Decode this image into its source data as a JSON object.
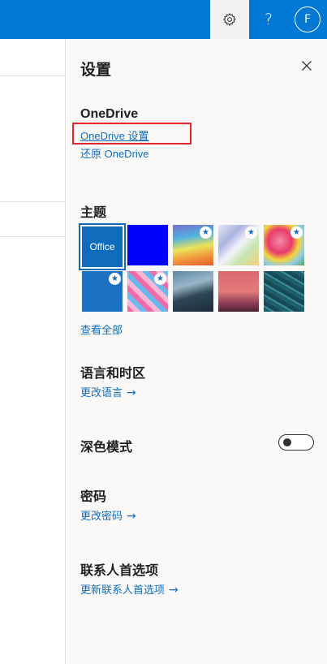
{
  "topbar": {
    "settings_icon": "gear-icon",
    "help_label": "?",
    "avatar_initial": "F",
    "bg_color": "#0078d4"
  },
  "panel": {
    "title": "设置",
    "close_icon": "close-icon",
    "onedrive": {
      "title": "OneDrive",
      "settings_link": "OneDrive 设置",
      "restore_link": "还原 OneDrive"
    },
    "theme": {
      "title": "主题",
      "items": [
        {
          "name": "Office",
          "label": "Office",
          "starred": false
        },
        {
          "name": "Blue",
          "starred": false
        },
        {
          "name": "Rainbow waves",
          "starred": true
        },
        {
          "name": "Pastel streaks",
          "starred": true
        },
        {
          "name": "Unicorn",
          "starred": true
        },
        {
          "name": "Blueprint",
          "starred": true
        },
        {
          "name": "Colorful circuit",
          "starred": true
        },
        {
          "name": "Mountain",
          "starred": false
        },
        {
          "name": "Palm sunset",
          "starred": false
        },
        {
          "name": "Circuit",
          "starred": false
        }
      ],
      "view_all": "查看全部"
    },
    "language": {
      "title": "语言和时区",
      "link": "更改语言"
    },
    "dark_mode": {
      "title": "深色模式",
      "enabled": false
    },
    "password": {
      "title": "密码",
      "link": "更改密码"
    },
    "contacts": {
      "title": "联系人首选项",
      "link": "更新联系人首选项"
    },
    "link_arrow": "→"
  },
  "colors": {
    "link": "#0f6cbd",
    "highlight_box": "#e0262b",
    "panel_bg": "#faf9f8"
  }
}
